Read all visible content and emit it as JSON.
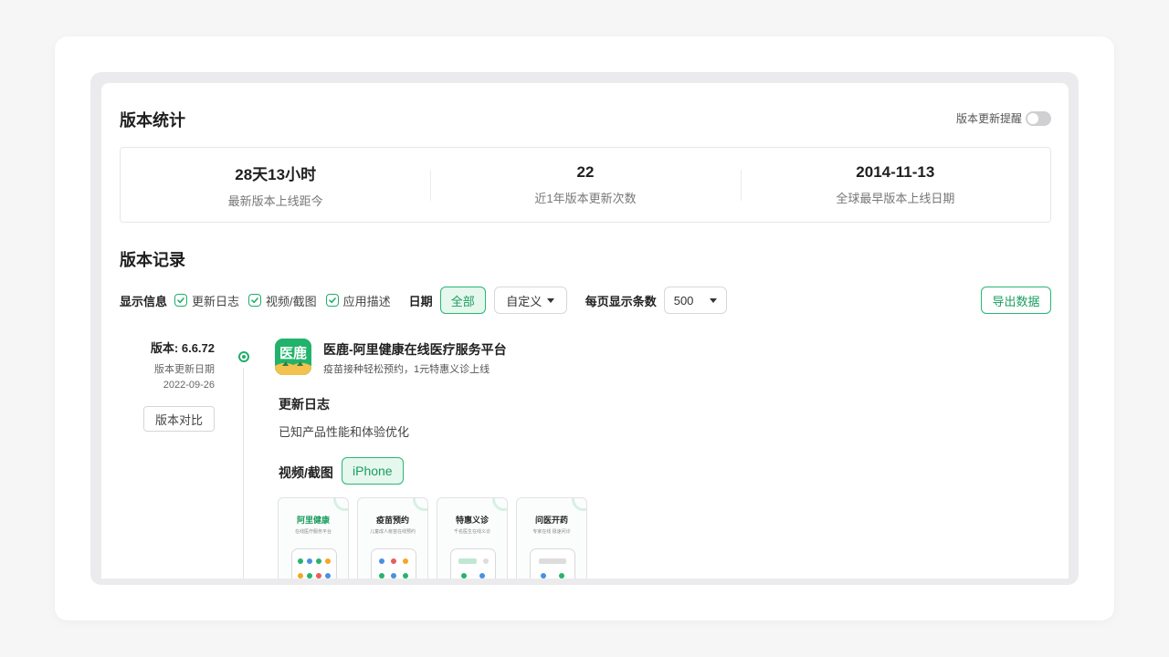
{
  "stats_section": {
    "title": "版本统计",
    "remind_label": "版本更新提醒",
    "remind_enabled": false,
    "items": [
      {
        "value": "28天13小时",
        "label": "最新版本上线距今"
      },
      {
        "value": "22",
        "label": "近1年版本更新次数"
      },
      {
        "value": "2014-11-13",
        "label": "全球最早版本上线日期"
      }
    ]
  },
  "records_section": {
    "title": "版本记录",
    "filters": {
      "display_info_label": "显示信息",
      "checkboxes": [
        {
          "label": "更新日志",
          "checked": true
        },
        {
          "label": "视频/截图",
          "checked": true
        },
        {
          "label": "应用描述",
          "checked": true
        }
      ],
      "date_label": "日期",
      "date_all": "全部",
      "date_custom": "自定义",
      "per_page_label": "每页显示条数",
      "per_page_value": "500",
      "export_label": "导出数据"
    }
  },
  "version": {
    "number": "版本: 6.6.72",
    "date_label": "版本更新日期",
    "date": "2022-09-26",
    "compare_label": "版本对比",
    "app_name": "医鹿-阿里健康在线医疗服务平台",
    "app_subtitle": "疫苗接种轻松预约，1元特惠义诊上线",
    "icon_text": "医鹿",
    "changelog_title": "更新日志",
    "changelog_text": "已知产品性能和体验优化",
    "media_title": "视频/截图",
    "device_tag": "iPhone",
    "screenshots": [
      {
        "title": "阿里健康",
        "subtitle": "在线医疗服务平台"
      },
      {
        "title": "疫苗预约",
        "subtitle": "儿童成人疫苗在线预约"
      },
      {
        "title": "特惠义诊",
        "subtitle": "千名医生在线义诊"
      },
      {
        "title": "问医开药",
        "subtitle": "专家在线 极速问诊"
      }
    ]
  },
  "colors": {
    "accent": "#1fae6a",
    "accent_bg": "#e6f7ee"
  }
}
